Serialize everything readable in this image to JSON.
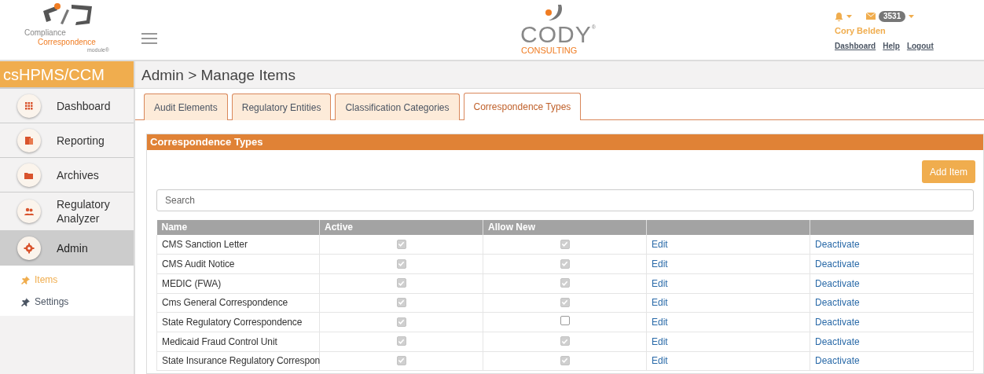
{
  "header": {
    "app_logo": {
      "line_1": "Compliance",
      "line_2": "Correspondence",
      "line_3": "module®"
    },
    "company_logo": {
      "name": "CODY",
      "mark": "®",
      "tagline": "CONSULTING"
    },
    "message_count": "3531",
    "user_name": "Cory Belden",
    "links": [
      "Dashboard",
      "Help",
      "Logout"
    ]
  },
  "sidebar": {
    "title": "csHPMS/CCM",
    "items": [
      {
        "label": "Dashboard",
        "kind": "grid",
        "selected": false
      },
      {
        "label": "Reporting",
        "kind": "report",
        "selected": false
      },
      {
        "label": "Archives",
        "kind": "folder",
        "selected": false
      },
      {
        "label": "Regulatory Analyzer",
        "kind": "users",
        "selected": false
      },
      {
        "label": "Admin",
        "kind": "gear",
        "selected": true
      }
    ],
    "sub_items": [
      {
        "label": "Items",
        "selected": true
      },
      {
        "label": "Settings",
        "selected": false
      }
    ]
  },
  "breadcrumb": "Admin > Manage Items",
  "tabs": [
    {
      "label": "Audit Elements",
      "selected": false
    },
    {
      "label": "Regulatory Entities",
      "selected": false
    },
    {
      "label": "Classification Categories",
      "selected": false
    },
    {
      "label": "Correspondence Types",
      "selected": true
    }
  ],
  "panel": {
    "title": "Correspondence Types",
    "add_button": "Add Item",
    "search": {
      "placeholder": "Search"
    },
    "table": {
      "columns": [
        "Name",
        "Active",
        "Allow New"
      ],
      "rows": [
        {
          "name": "CMS Sanction Letter",
          "active": true,
          "allow_new": true,
          "edit": "Edit",
          "deactivate": "Deactivate"
        },
        {
          "name": "CMS Audit Notice",
          "active": true,
          "allow_new": true,
          "edit": "Edit",
          "deactivate": "Deactivate"
        },
        {
          "name": "MEDIC (FWA)",
          "active": true,
          "allow_new": true,
          "edit": "Edit",
          "deactivate": "Deactivate"
        },
        {
          "name": "Cms General Correspondence",
          "active": true,
          "allow_new": true,
          "edit": "Edit",
          "deactivate": "Deactivate"
        },
        {
          "name": "State Regulatory Correspondence",
          "active": true,
          "allow_new": false,
          "edit": "Edit",
          "deactivate": "Deactivate"
        },
        {
          "name": "Medicaid Fraud Control Unit",
          "active": true,
          "allow_new": true,
          "edit": "Edit",
          "deactivate": "Deactivate"
        },
        {
          "name": "State Insurance Regulatory Correspon",
          "active": true,
          "allow_new": true,
          "edit": "Edit",
          "deactivate": "Deactivate"
        }
      ]
    }
  }
}
